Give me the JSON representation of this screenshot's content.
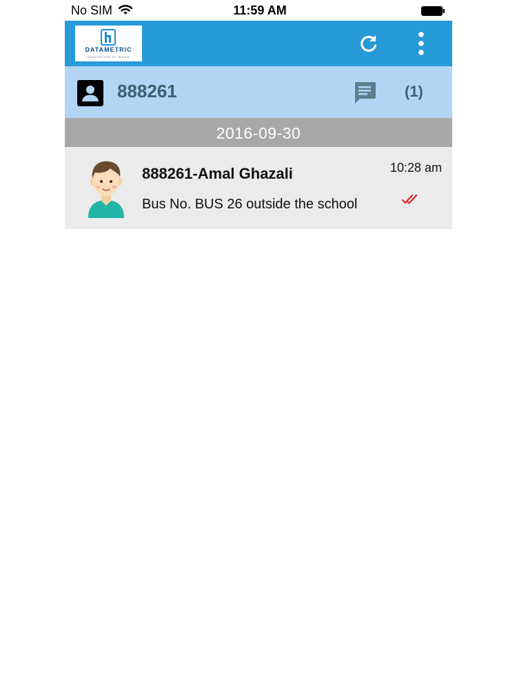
{
  "status_bar": {
    "carrier": "No SIM",
    "time": "11:59 AM"
  },
  "toolbar": {
    "logo_text": "DATAMETRIC",
    "logo_tagline": "INNOVATION AT WORK",
    "refresh_icon": "refresh-icon",
    "menu_icon": "more-vert-icon",
    "color": "#279ad8"
  },
  "contact": {
    "id": "888261",
    "message_count": "(1)",
    "color": "#b2d5f4"
  },
  "messages": {
    "date": "2016-09-30",
    "items": [
      {
        "sender": "888261-Amal Ghazali",
        "time": "10:28 am",
        "text": "Bus No. BUS 26 outside the school",
        "status_icon": "double-check-icon",
        "status_color": "#e0232b"
      }
    ]
  }
}
